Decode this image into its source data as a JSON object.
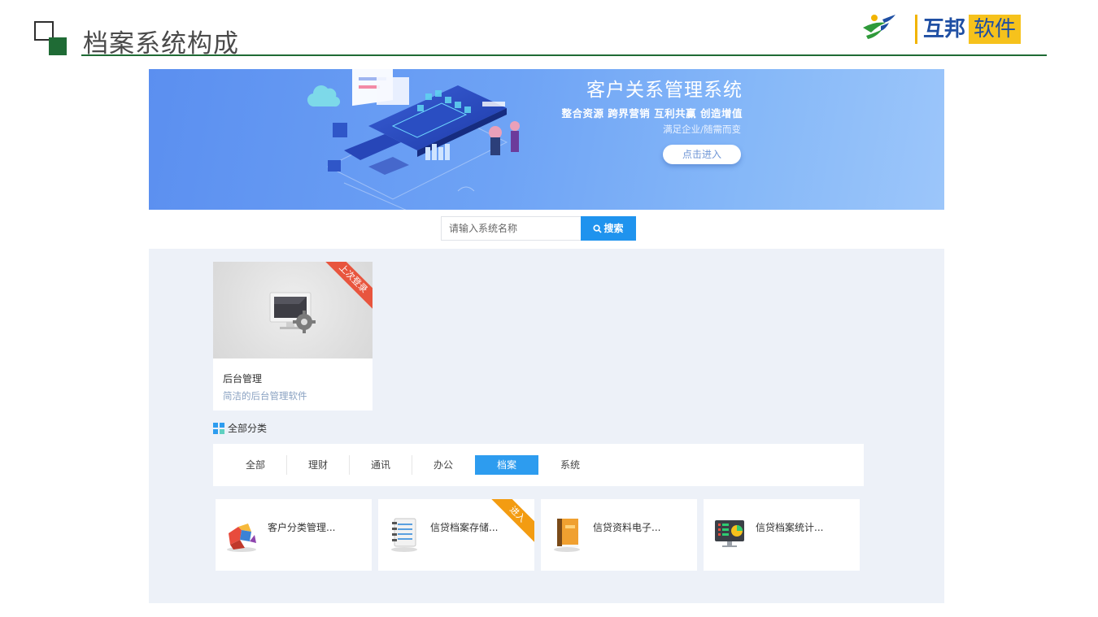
{
  "slide": {
    "title": "档案系统构成",
    "logo_part1": "互邦",
    "logo_part2": "软件"
  },
  "banner": {
    "title": "客户关系管理系统",
    "subtitle": "整合资源 跨界营销 互利共赢 创造增值",
    "tagline": "满足企业/随需而变",
    "button": "点击进入"
  },
  "search": {
    "placeholder": "请输入系统名称",
    "button": "搜索"
  },
  "recent": {
    "badge": "上次登录",
    "name": "后台管理",
    "desc": "简洁的后台管理软件"
  },
  "categories": {
    "heading": "全部分类",
    "tabs": [
      "全部",
      "理财",
      "通讯",
      "办公",
      "档案",
      "系统"
    ],
    "active": "档案"
  },
  "apps": [
    {
      "name": "客户分类管理...",
      "icon": "puzzle-icon"
    },
    {
      "name": "信贷档案存储...",
      "icon": "notebook-icon",
      "badge": "进入"
    },
    {
      "name": "信贷资料电子...",
      "icon": "book-icon"
    },
    {
      "name": "信贷档案统计...",
      "icon": "dashboard-monitor-icon"
    }
  ],
  "colors": {
    "accent_green": "#1f6b35",
    "search_blue": "#1f93ee",
    "tab_active": "#2d9cef",
    "ribbon_red": "#e8553e",
    "ribbon_orange": "#f39c12"
  }
}
